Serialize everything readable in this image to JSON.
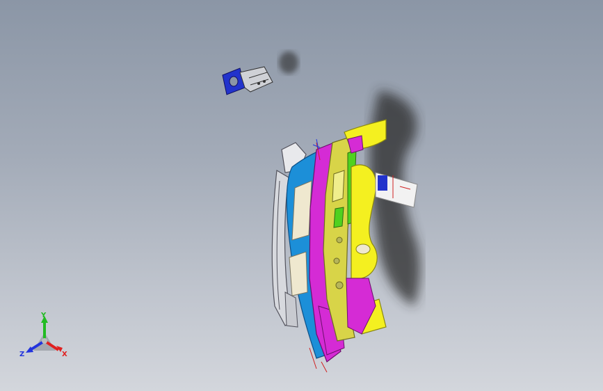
{
  "viewport": {
    "background_top": "#8b96a6",
    "background_bottom": "#d3d6dc"
  },
  "model": {
    "part_colors": {
      "yellow": "#f4f020",
      "magenta": "#d52bd5",
      "blue": "#1c8fd8",
      "green": "#4fd11f",
      "cream": "#efe8cf",
      "olive": "#b6b55a",
      "dark_gray": "#52525c",
      "shadow": "#2a2a2a"
    },
    "bracket_color": "#2233cc"
  },
  "triad": {
    "x_label": "X",
    "y_label": "Y",
    "z_label": "Z",
    "x_color": "#e02020",
    "y_color": "#22bb22",
    "z_color": "#2233dd"
  }
}
